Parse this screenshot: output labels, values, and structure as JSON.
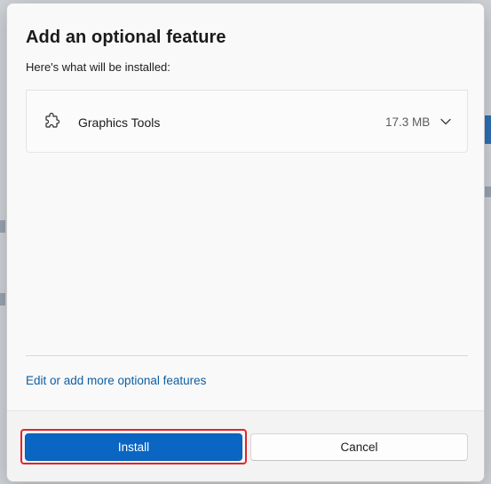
{
  "dialog": {
    "title": "Add an optional feature",
    "subtitle": "Here's what will be installed:",
    "features": [
      {
        "icon": "puzzle-piece-icon",
        "name": "Graphics Tools",
        "size": "17.3 MB"
      }
    ],
    "more_link": "Edit or add more optional features"
  },
  "footer": {
    "install_label": "Install",
    "cancel_label": "Cancel"
  },
  "colors": {
    "accent": "#0a66c2",
    "link": "#0f5ea3",
    "highlight": "#e3242b"
  }
}
